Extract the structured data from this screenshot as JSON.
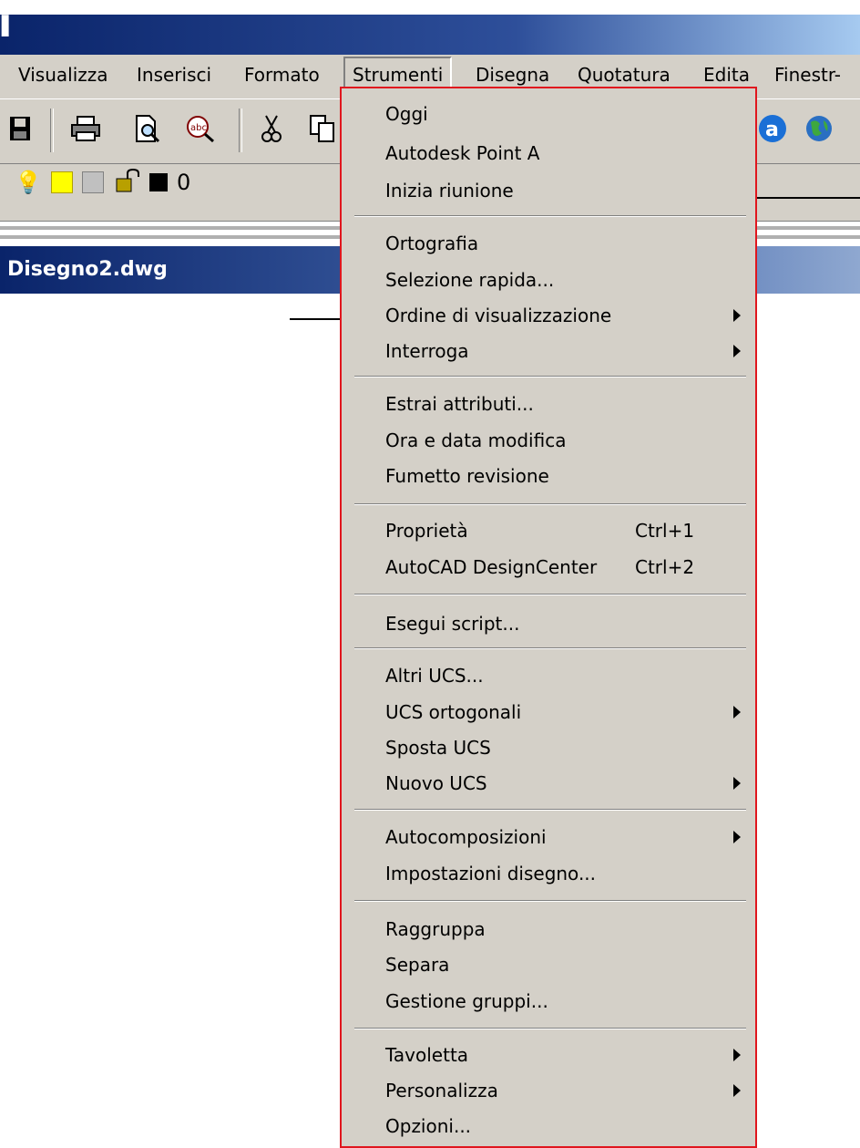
{
  "menubar": {
    "items": [
      {
        "label": "Visualizza"
      },
      {
        "label": "Inserisci"
      },
      {
        "label": "Formato"
      },
      {
        "label": "Strumenti"
      },
      {
        "label": "Disegna"
      },
      {
        "label": "Quotatura"
      },
      {
        "label": "Edita"
      },
      {
        "label": "Finestr-"
      }
    ]
  },
  "toolbar": {
    "icons": [
      "save-icon",
      "print-icon",
      "print-preview-icon",
      "spell-check-icon",
      "cut-icon",
      "copy-icon",
      "autocad-a-icon",
      "globe-icon"
    ]
  },
  "layer": {
    "name": "0"
  },
  "document": {
    "title": "Disegno2.dwg"
  },
  "menu": {
    "items": [
      {
        "label": "Oggi",
        "shortcut": "",
        "submenu": false
      },
      {
        "label": "Autodesk Point A",
        "shortcut": "",
        "submenu": false
      },
      {
        "label": "Inizia riunione",
        "shortcut": "",
        "submenu": false
      },
      {
        "label": "Ortografia",
        "shortcut": "",
        "submenu": false
      },
      {
        "label": "Selezione rapida...",
        "shortcut": "",
        "submenu": false
      },
      {
        "label": "Ordine di visualizzazione",
        "shortcut": "",
        "submenu": true
      },
      {
        "label": "Interroga",
        "shortcut": "",
        "submenu": true
      },
      {
        "label": "Estrai attributi...",
        "shortcut": "",
        "submenu": false
      },
      {
        "label": "Ora e data modifica",
        "shortcut": "",
        "submenu": false
      },
      {
        "label": "Fumetto revisione",
        "shortcut": "",
        "submenu": false
      },
      {
        "label": "Proprietà",
        "shortcut": "Ctrl+1",
        "submenu": false
      },
      {
        "label": "AutoCAD DesignCenter",
        "shortcut": "Ctrl+2",
        "submenu": false
      },
      {
        "label": "Esegui script...",
        "shortcut": "",
        "submenu": false
      },
      {
        "label": "Altri UCS...",
        "shortcut": "",
        "submenu": false
      },
      {
        "label": "UCS ortogonali",
        "shortcut": "",
        "submenu": true
      },
      {
        "label": "Sposta UCS",
        "shortcut": "",
        "submenu": false
      },
      {
        "label": "Nuovo UCS",
        "shortcut": "",
        "submenu": true
      },
      {
        "label": "Autocomposizioni",
        "shortcut": "",
        "submenu": true
      },
      {
        "label": "Impostazioni disegno...",
        "shortcut": "",
        "submenu": false
      },
      {
        "label": "Raggruppa",
        "shortcut": "",
        "submenu": false
      },
      {
        "label": "Separa",
        "shortcut": "",
        "submenu": false
      },
      {
        "label": "Gestione gruppi...",
        "shortcut": "",
        "submenu": false
      },
      {
        "label": "Tavoletta",
        "shortcut": "",
        "submenu": true
      },
      {
        "label": "Personalizza",
        "shortcut": "",
        "submenu": true
      },
      {
        "label": "Opzioni...",
        "shortcut": "",
        "submenu": false
      }
    ]
  }
}
